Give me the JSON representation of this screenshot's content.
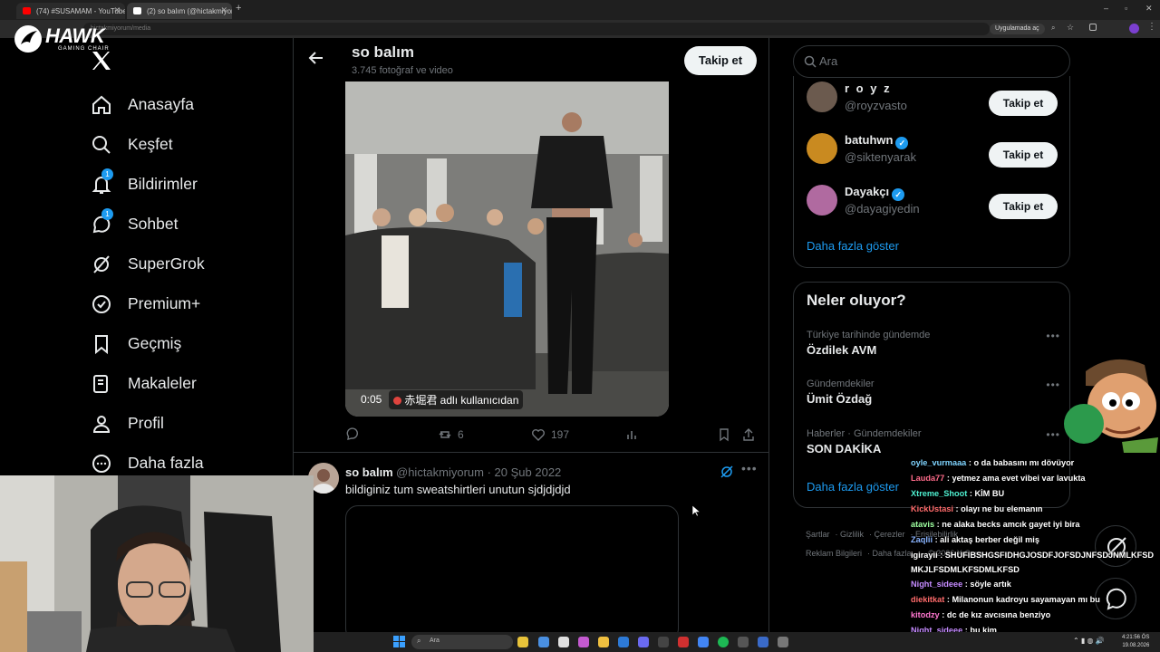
{
  "browser": {
    "tabs": [
      {
        "label": "(74) #SUSAMAM - YouTube",
        "favicon_color": "#ff0000"
      },
      {
        "label": "(2) so balım (@hictakmiyorum) /",
        "favicon_color": "#ffffff"
      }
    ],
    "new_tab": "+",
    "url": "hictakmiyorum/media",
    "app_chip": "Uygulamada aç"
  },
  "stream_logo": {
    "title": "HAWK",
    "subtitle": "GAMING CHAIR"
  },
  "nav": {
    "items": [
      {
        "label": "Anasayfa",
        "icon": "home-icon"
      },
      {
        "label": "Keşfet",
        "icon": "search-icon"
      },
      {
        "label": "Bildirimler",
        "icon": "bell-icon",
        "badge": "1"
      },
      {
        "label": "Sohbet",
        "icon": "chat-icon",
        "badge": "1"
      },
      {
        "label": "SuperGrok",
        "icon": "grok-icon"
      },
      {
        "label": "Premium+",
        "icon": "premium-icon"
      },
      {
        "label": "Geçmiş",
        "icon": "bookmark-icon"
      },
      {
        "label": "Makaleler",
        "icon": "articles-icon"
      },
      {
        "label": "Profil",
        "icon": "profile-icon"
      },
      {
        "label": "Daha fazla",
        "icon": "more-icon"
      }
    ]
  },
  "header": {
    "title": "so balım",
    "subtitle": "3.745 fotoğraf ve video",
    "follow": "Takip et"
  },
  "tweet1": {
    "video_time": "0:05",
    "attribution": "赤堀君 adlı kullanıcıdan",
    "retweets": "6",
    "likes": "197"
  },
  "tweet2": {
    "name": "so balım",
    "handle": "@hictakmiyorum · 20 Şub 2022",
    "text": "bildiginiz tum sweatshirtleri unutun sjdjdjdjd"
  },
  "search": {
    "placeholder": "Ara"
  },
  "who_to_follow": {
    "users": [
      {
        "name": "r o y z",
        "handle": "@royzvasto",
        "verified": false,
        "button": "Takip et",
        "color": "#6b5a4e"
      },
      {
        "name": "batuhwn",
        "handle": "@siktenyarak",
        "verified": true,
        "button": "Takip et",
        "color": "#c98a20"
      },
      {
        "name": "Dayakçı",
        "handle": "@dayagiyedin",
        "verified": true,
        "button": "Takip et",
        "color": "#b06aa0"
      }
    ],
    "show_more": "Daha fazla göster"
  },
  "trends": {
    "title": "Neler oluyor?",
    "items": [
      {
        "context": "Türkiye tarihinde gündemde",
        "name": "Özdilek AVM"
      },
      {
        "context": "Gündemdekiler",
        "name": "Ümit Özdağ"
      },
      {
        "context": "Haberler · Gündemdekiler",
        "name": "SON DAKİKA"
      }
    ],
    "show_more": "Daha fazla göster"
  },
  "footer": {
    "links": [
      "Şartlar",
      "Gizlilik",
      "Çerezler",
      "Erişilebilirlik",
      "Reklam Bilgileri",
      "Daha fazla ...",
      "© 2026 X Corp."
    ]
  },
  "chat": {
    "messages": [
      {
        "user": "oyle_vurmaaa",
        "text": ": o da babasını mı dövüyor",
        "color": "#7fd4ff"
      },
      {
        "user": "Lauda77",
        "text": ": yetmez ama evet vibei var lavukta",
        "color": "#ff6b8a"
      },
      {
        "user": "Xtreme_Shoot",
        "text": ": KİM BU",
        "color": "#4ef0d0"
      },
      {
        "user": "KickUstasi",
        "text": ": olayı ne bu elemanın",
        "color": "#ff6b6b"
      },
      {
        "user": "atavis",
        "text": ": ne alaka becks amcık gayet iyi bira",
        "color": "#9effa0"
      },
      {
        "user": "Zaqlii",
        "text": ": ali aktaş berber değil miş",
        "color": "#8ab4ff"
      },
      {
        "user": "igirayii",
        "text": ": SHUFIBSHGSFIDHGJOSDFJOFSDJNFSDJNMLKFSDMKJLFSDMLKFSDMLKFSD",
        "color": "#ffffff"
      },
      {
        "user": "Night_sideee",
        "text": ": söyle artık",
        "color": "#c58bff"
      },
      {
        "user": "diekitkat",
        "text": ": Milanonun kadroyu sayamayan mı bu",
        "color": "#ff6b6b"
      },
      {
        "user": "kitodzy",
        "text": ": dc de kız avcısına benziyo",
        "color": "#ff77d0"
      },
      {
        "user": "Night_sideee",
        "text": ": bu kim",
        "color": "#c58bff"
      }
    ]
  },
  "taskbar": {
    "search": "Ara",
    "time": "4:21:56 ÖS",
    "date": "19.08.2026"
  }
}
